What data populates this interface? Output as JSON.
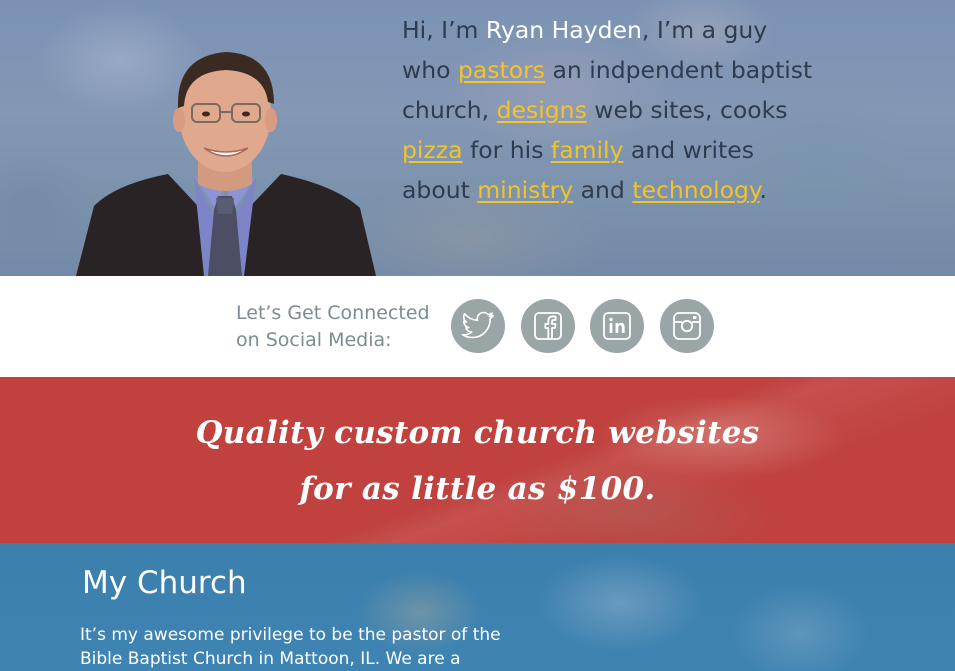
{
  "hero": {
    "intro_prefix": "Hi, I’m ",
    "name": "Ryan Hayden",
    "intro_after_name": ", I’m a guy who ",
    "link_pastors": "pastors",
    "text_after_pastors": " an indpendent baptist church, ",
    "link_designs": "designs",
    "text_after_designs": " web sites, cooks ",
    "link_pizza": "pizza",
    "text_after_pizza": " for his ",
    "link_family": "family",
    "text_after_family": " and writes about ",
    "link_ministry": "ministry",
    "text_between": " and ",
    "link_technology": "technology",
    "text_end": ".",
    "link_color": "#f2c42a"
  },
  "social": {
    "label": "Let’s Get Connected on Social Media:",
    "icons": [
      "twitter-icon",
      "facebook-icon",
      "linkedin-icon",
      "instagram-icon"
    ],
    "icon_color": "#9aa5a8"
  },
  "promo": {
    "line1": "Quality custom church websites",
    "line2": "for as little as $100.",
    "background": "#c0413e"
  },
  "church": {
    "title": "My Church",
    "body": "It’s my awesome privilege to be the pastor of the Bible Baptist Church in Mattoon, IL.  We are a",
    "background": "#3b7fad"
  }
}
